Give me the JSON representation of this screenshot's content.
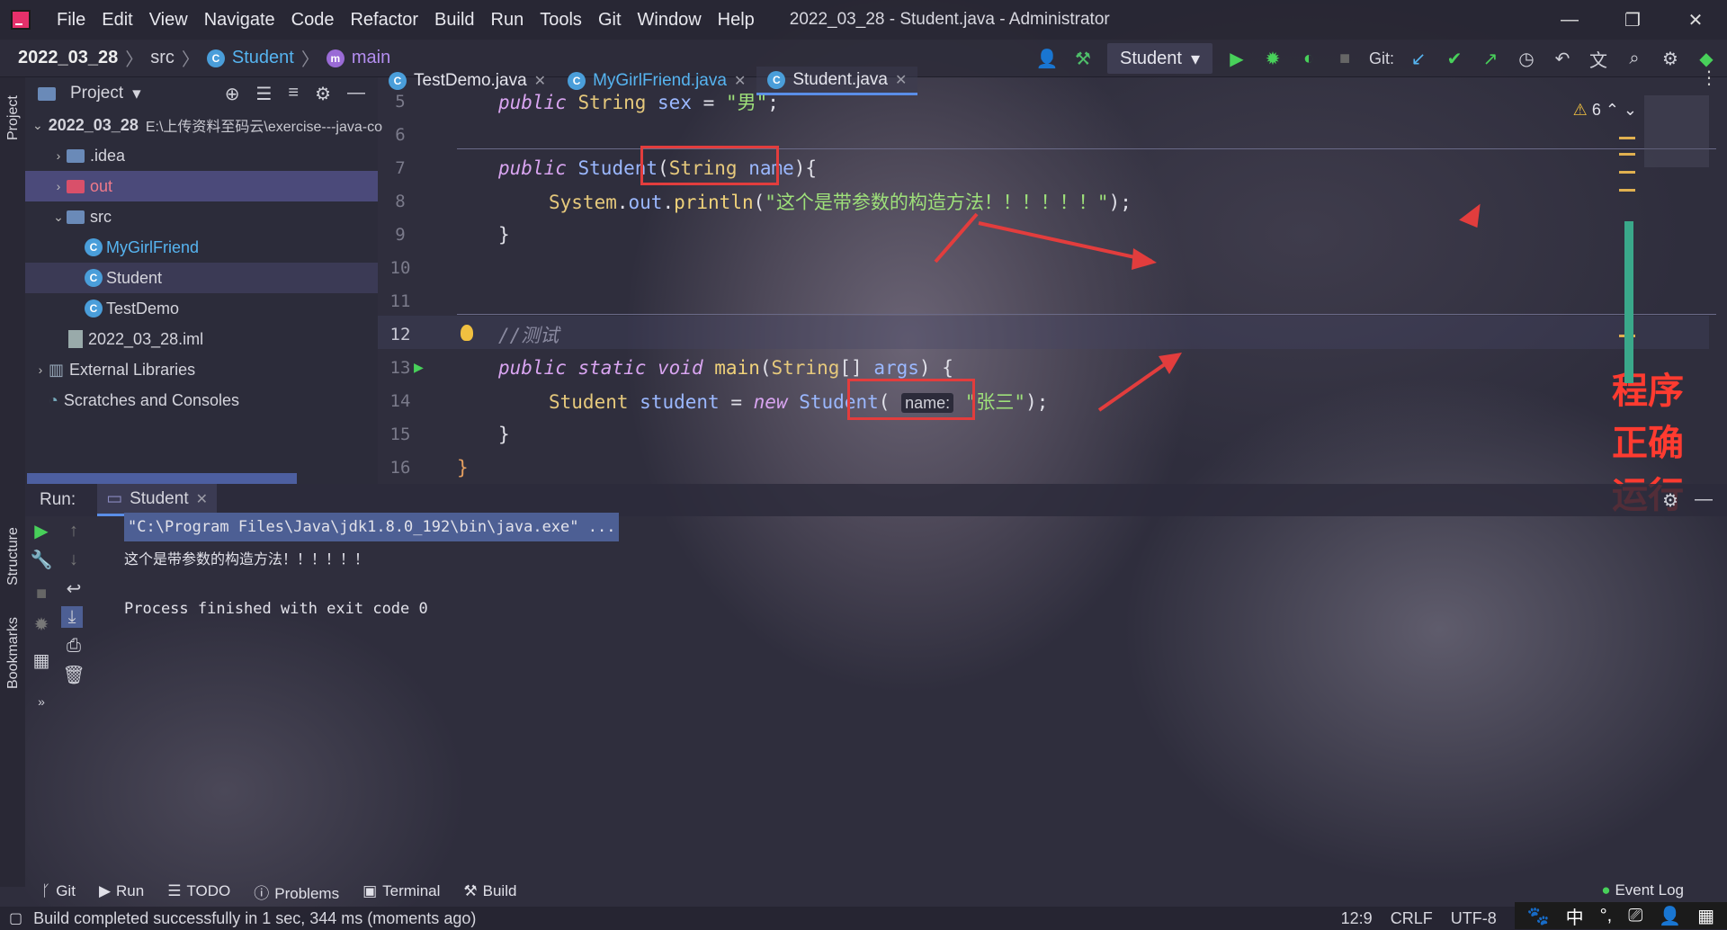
{
  "titlebar": {
    "menu": [
      "File",
      "Edit",
      "View",
      "Navigate",
      "Code",
      "Refactor",
      "Build",
      "Run",
      "Tools",
      "Git",
      "Window",
      "Help"
    ],
    "title": "2022_03_28 - Student.java - Administrator"
  },
  "breadcrumb": {
    "project": "2022_03_28",
    "folder": "src",
    "class": "Student",
    "method": "main"
  },
  "toolbar": {
    "run_config": "Student",
    "git_label": "Git:"
  },
  "sidebar": {
    "project_label": "Project",
    "structure_label": "Structure",
    "bookmarks_label": "Bookmarks"
  },
  "project": {
    "title": "Project",
    "root_name": "2022_03_28",
    "root_path": "E:\\上传资料至码云\\exercise---java-co",
    "items": [
      ".idea",
      "out",
      "src",
      "MyGirlFriend",
      "Student",
      "TestDemo",
      "2022_03_28.iml",
      "External Libraries",
      "Scratches and Consoles"
    ]
  },
  "tabs": [
    {
      "label": "TestDemo.java"
    },
    {
      "label": "MyGirlFriend.java"
    },
    {
      "label": "Student.java"
    }
  ],
  "editor": {
    "warnings": "6",
    "line_numbers": [
      "5",
      "6",
      "7",
      "8",
      "9",
      "10",
      "11",
      "12",
      "13",
      "14",
      "15",
      "16"
    ],
    "inlay_hint": "name:",
    "annotation": "程序正确运行"
  },
  "run": {
    "label": "Run:",
    "tab": "Student",
    "command": "\"C:\\Program Files\\Java\\jdk1.8.0_192\\bin\\java.exe\" ...",
    "output": "这个是带参数的构造方法！！！！！！",
    "exit": "Process finished with exit code 0"
  },
  "bottom_tabs": [
    "Git",
    "Run",
    "TODO",
    "Problems",
    "Terminal",
    "Build"
  ],
  "event_log": "Event Log",
  "status": {
    "message": "Build completed successfully in 1 sec, 344 ms (moments ago)",
    "position": "12:9",
    "line_sep": "CRLF",
    "encoding": "UTF-8"
  },
  "colors": {
    "accent": "#5a8ee8",
    "annotation_red": "#ff3b30",
    "box_red": "#e23d3d",
    "run_green": "#48d05a"
  }
}
